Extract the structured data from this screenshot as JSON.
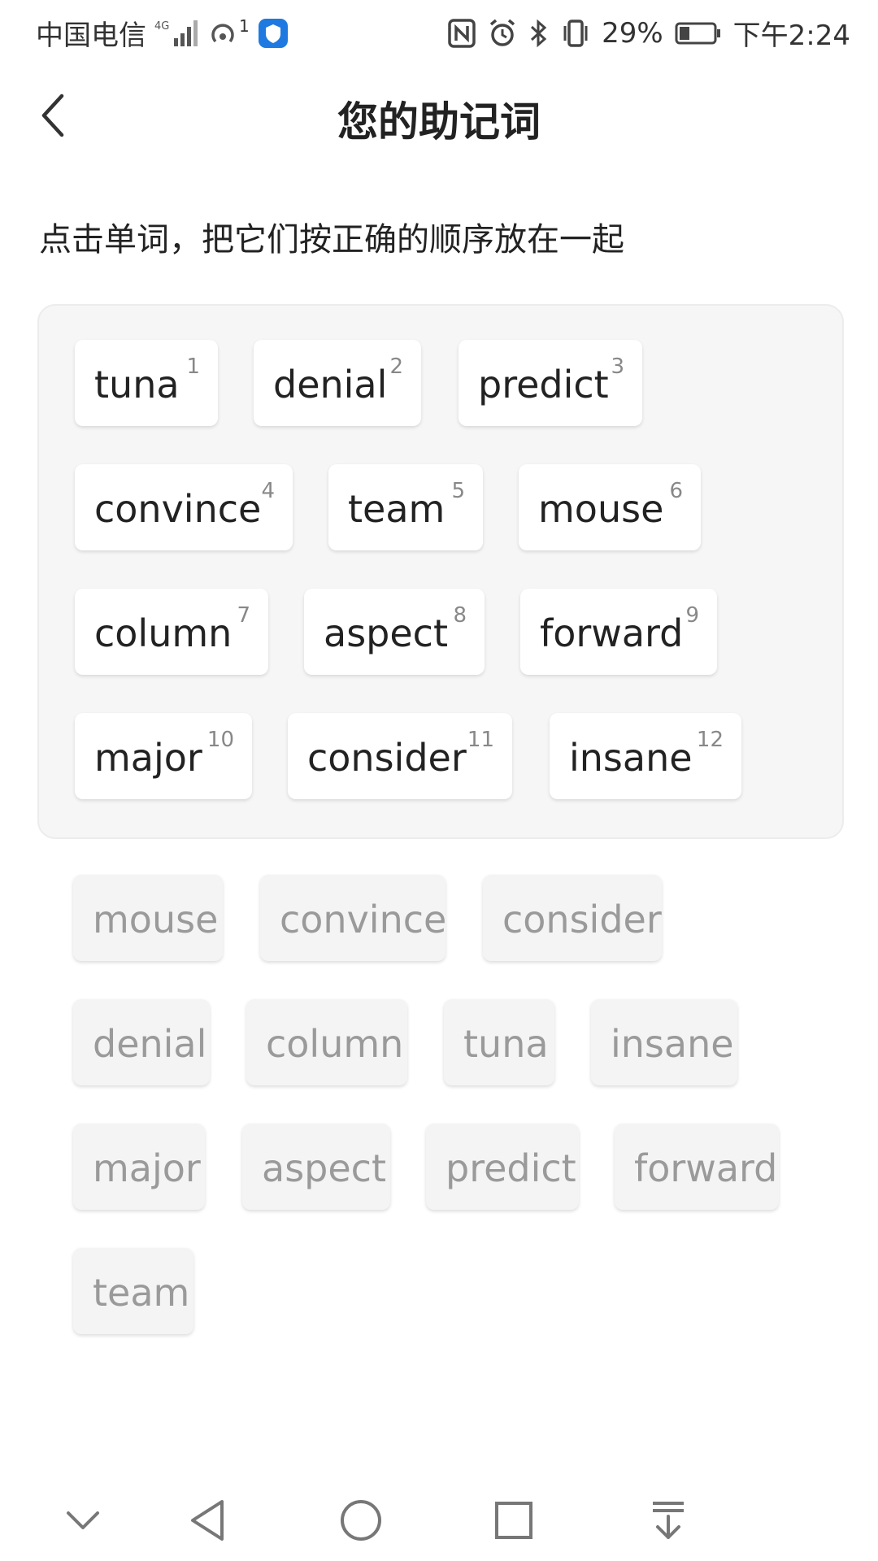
{
  "status_bar": {
    "carrier": "中国电信",
    "network": "4G",
    "hotspot_badge": "1",
    "battery": "29%",
    "time": "下午2:24"
  },
  "header": {
    "back_icon": "chevron-left-icon",
    "title": "您的助记词"
  },
  "instruction": "点击单词，把它们按正确的顺序放在一起",
  "selected_words": [
    {
      "word": "tuna",
      "index": "1"
    },
    {
      "word": "denial",
      "index": "2"
    },
    {
      "word": "predict",
      "index": "3"
    },
    {
      "word": "convince",
      "index": "4"
    },
    {
      "word": "team",
      "index": "5"
    },
    {
      "word": "mouse",
      "index": "6"
    },
    {
      "word": "column",
      "index": "7"
    },
    {
      "word": "aspect",
      "index": "8"
    },
    {
      "word": "forward",
      "index": "9"
    },
    {
      "word": "major",
      "index": "10"
    },
    {
      "word": "consider",
      "index": "11"
    },
    {
      "word": "insane",
      "index": "12"
    }
  ],
  "option_words": [
    "mouse",
    "convince",
    "consider",
    "denial",
    "column",
    "tuna",
    "insane",
    "major",
    "aspect",
    "predict",
    "forward",
    "team"
  ],
  "nav_bar": {
    "icons": [
      "chevron-down-icon",
      "back-triangle-icon",
      "home-circle-icon",
      "recents-square-icon",
      "notification-pull-icon"
    ]
  },
  "colors": {
    "panel_bg": "#f6f6f6",
    "selected_word_bg": "#ffffff",
    "option_word_bg": "#f4f4f4",
    "option_text": "#9a9a9a"
  }
}
